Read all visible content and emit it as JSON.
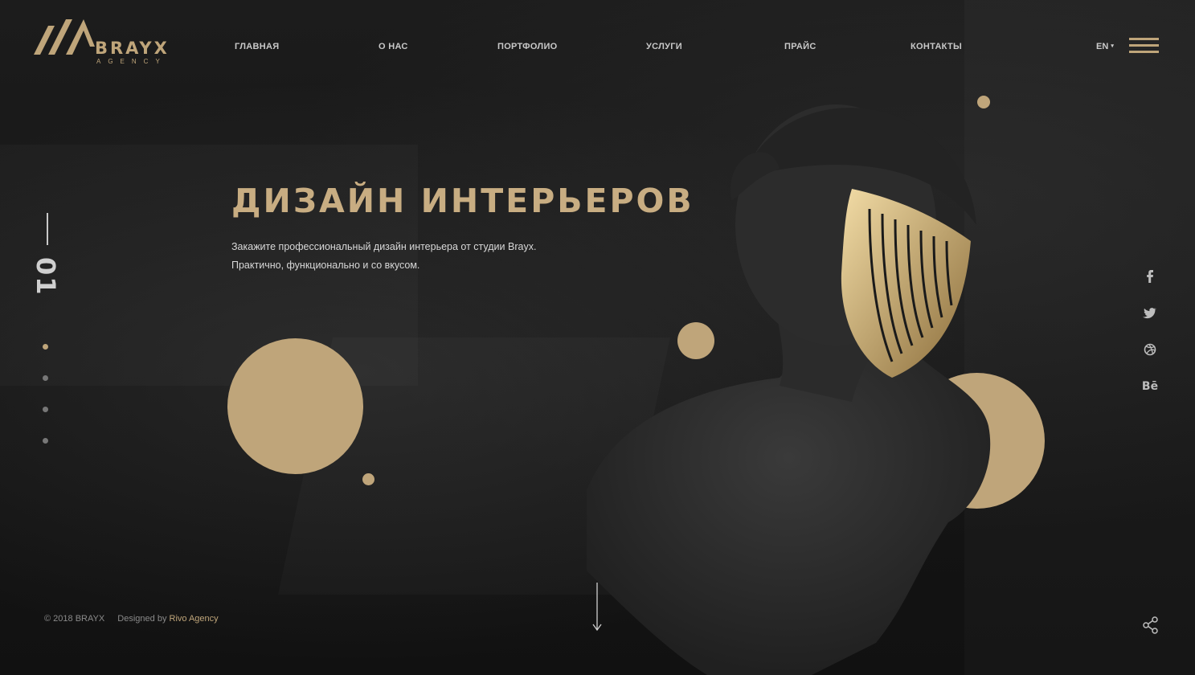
{
  "brand": {
    "name": "BRAYX",
    "sub": "AGENCY"
  },
  "nav": {
    "items": [
      "ГЛАВНАЯ",
      "О НАС",
      "ПОРТФОЛИО",
      "УСЛУГИ",
      "ПРАЙС",
      "КОНТАКТЫ"
    ]
  },
  "lang": {
    "current": "EN"
  },
  "menu": {
    "icon": "hamburger-icon"
  },
  "slider": {
    "current": "01",
    "dots": 4,
    "active_dot": 0
  },
  "hero": {
    "title": "ДИЗАЙН ИНТЕРЬЕРОВ",
    "description": "Закажите профессиональный дизайн интерьера от студии Brayx. Практично, функционально и со вкусом."
  },
  "social": {
    "icons": [
      "facebook-icon",
      "twitter-icon",
      "dribbble-icon",
      "behance-icon"
    ],
    "behance_label": "Bē"
  },
  "footer": {
    "copyright": "© 2018 BRAYX",
    "designed_by": "Designed by",
    "designer": "Rivo Agency"
  },
  "colors": {
    "accent": "#bfa57a",
    "background": "#161616",
    "text": "#d8d8d8"
  }
}
